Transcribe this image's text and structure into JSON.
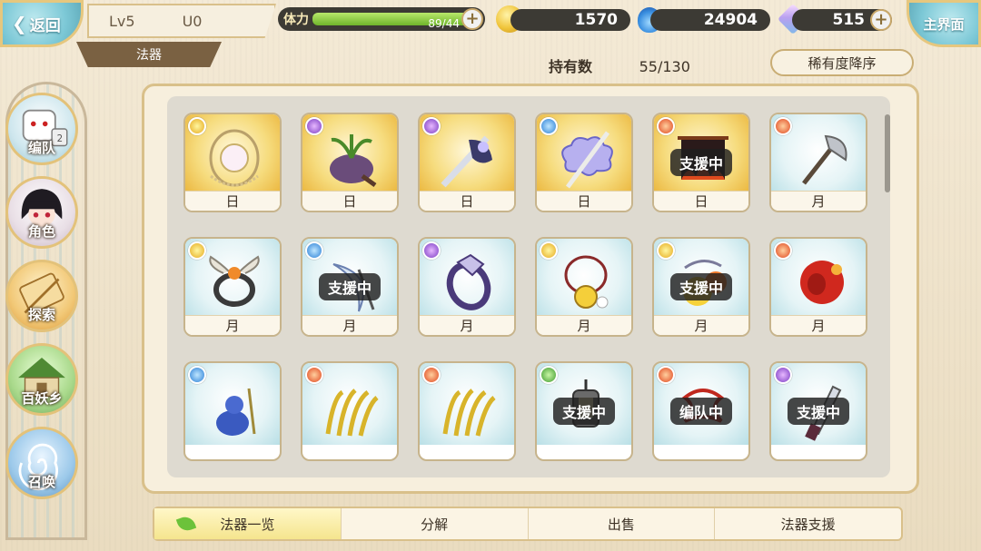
{
  "header": {
    "back_label": "返回",
    "level": "Lv5",
    "uid": "U0",
    "category": "法器",
    "home_label": "主界面",
    "stamina_label": "体力",
    "stamina_text": "89/44",
    "stamina_fraction": 1.0,
    "coins": "1570",
    "souls": "24904",
    "gems": "515"
  },
  "inventory": {
    "held_label": "持有数",
    "held_value": "55/130",
    "sort_label": "稀有度降序"
  },
  "sidebar": {
    "items": [
      {
        "label": "编队"
      },
      {
        "label": "角色"
      },
      {
        "label": "探索"
      },
      {
        "label": "百妖乡"
      },
      {
        "label": "召唤"
      }
    ]
  },
  "grid": {
    "items": [
      {
        "name": "日",
        "element": "light",
        "frame": "gold",
        "badge": "",
        "icon": "orb-amulet-icon"
      },
      {
        "name": "日",
        "element": "dark",
        "frame": "gold",
        "badge": "",
        "icon": "mortar-plant-icon"
      },
      {
        "name": "日",
        "element": "dark",
        "frame": "gold",
        "badge": "",
        "icon": "demon-blade-icon"
      },
      {
        "name": "日",
        "element": "water",
        "frame": "gold",
        "badge": "",
        "icon": "cloud-sword-icon"
      },
      {
        "name": "日",
        "element": "fire",
        "frame": "gold",
        "badge": "支援中",
        "icon": "fire-banner-icon"
      },
      {
        "name": "月",
        "element": "fire",
        "frame": "blue",
        "badge": "",
        "icon": "axe-icon"
      },
      {
        "name": "月",
        "element": "light",
        "frame": "blue",
        "badge": "",
        "icon": "winged-ring-icon"
      },
      {
        "name": "月",
        "element": "water",
        "frame": "blue",
        "badge": "支援中",
        "icon": "crescent-blade-icon"
      },
      {
        "name": "月",
        "element": "dark",
        "frame": "blue",
        "badge": "",
        "icon": "crystal-bracelet-icon"
      },
      {
        "name": "月",
        "element": "light",
        "frame": "blue",
        "badge": "",
        "icon": "bell-necklace-icon"
      },
      {
        "name": "月",
        "element": "light",
        "frame": "blue",
        "badge": "支援中",
        "icon": "lemon-charm-icon"
      },
      {
        "name": "月",
        "element": "fire",
        "frame": "blue",
        "badge": "",
        "icon": "red-mask-icon"
      },
      {
        "name": "",
        "element": "water",
        "frame": "blue",
        "badge": "",
        "icon": "blue-gourd-icon"
      },
      {
        "name": "",
        "element": "fire",
        "frame": "blue",
        "badge": "",
        "icon": "golden-tails-icon"
      },
      {
        "name": "",
        "element": "fire",
        "frame": "blue",
        "badge": "",
        "icon": "golden-tails-icon"
      },
      {
        "name": "",
        "element": "wind",
        "frame": "blue",
        "badge": "支援中",
        "icon": "lantern-icon"
      },
      {
        "name": "",
        "element": "fire",
        "frame": "blue",
        "badge": "编队中",
        "icon": "red-ribbon-icon"
      },
      {
        "name": "",
        "element": "dark",
        "frame": "blue",
        "badge": "支援中",
        "icon": "knife-icon"
      }
    ]
  },
  "tabs": [
    {
      "label": "法器一览",
      "active": true
    },
    {
      "label": "分解",
      "active": false
    },
    {
      "label": "出售",
      "active": false
    },
    {
      "label": "法器支援",
      "active": false
    }
  ],
  "colors": {
    "accent_gold": "#e6c77e",
    "panel": "#f7efdd",
    "grid_bg": "#dedad0",
    "stamina": "#6fb52b"
  }
}
